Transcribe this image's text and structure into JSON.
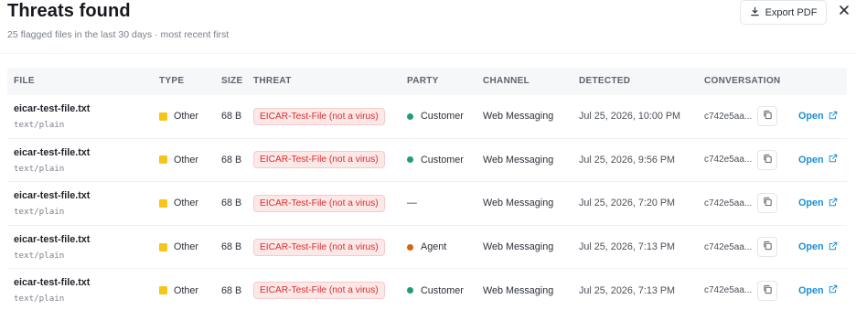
{
  "header": {
    "title": "Threats found",
    "subtitle": "25 flagged files in the last 30 days · most recent first",
    "export_label": "Export PDF"
  },
  "columns": {
    "file": "FILE",
    "type": "TYPE",
    "size": "SIZE",
    "threat": "THREAT",
    "party": "PARTY",
    "channel": "CHANNEL",
    "detected": "DETECTED",
    "conversation": "CONVERSATION"
  },
  "colors": {
    "type_other": "#f5c518",
    "party_customer": "#1f9e6e",
    "party_agent": "#d9630f",
    "threat_text": "#d92d2d",
    "threat_bg": "#fde8e8",
    "link": "#1a8ed6"
  },
  "rows": [
    {
      "file": "eicar-test-file.txt",
      "mime": "text/plain",
      "type": "Other",
      "size": "68 B",
      "threat": "EICAR-Test-File (not a virus)",
      "party": "Customer",
      "party_kind": "customer",
      "channel": "Web Messaging",
      "detected": "Jul 25, 2026, 10:00 PM",
      "conversation": "c742e5aa...",
      "open": "Open"
    },
    {
      "file": "eicar-test-file.txt",
      "mime": "text/plain",
      "type": "Other",
      "size": "68 B",
      "threat": "EICAR-Test-File (not a virus)",
      "party": "Customer",
      "party_kind": "customer",
      "channel": "Web Messaging",
      "detected": "Jul 25, 2026, 9:56 PM",
      "conversation": "c742e5aa...",
      "open": "Open"
    },
    {
      "file": "eicar-test-file.txt",
      "mime": "text/plain",
      "type": "Other",
      "size": "68 B",
      "threat": "EICAR-Test-File (not a virus)",
      "party": "—",
      "party_kind": "none",
      "channel": "Web Messaging",
      "detected": "Jul 25, 2026, 7:20 PM",
      "conversation": "c742e5aa...",
      "open": "Open"
    },
    {
      "file": "eicar-test-file.txt",
      "mime": "text/plain",
      "type": "Other",
      "size": "68 B",
      "threat": "EICAR-Test-File (not a virus)",
      "party": "Agent",
      "party_kind": "agent",
      "channel": "Web Messaging",
      "detected": "Jul 25, 2026, 7:13 PM",
      "conversation": "c742e5aa...",
      "open": "Open"
    },
    {
      "file": "eicar-test-file.txt",
      "mime": "text/plain",
      "type": "Other",
      "size": "68 B",
      "threat": "EICAR-Test-File (not a virus)",
      "party": "Customer",
      "party_kind": "customer",
      "channel": "Web Messaging",
      "detected": "Jul 25, 2026, 7:13 PM",
      "conversation": "c742e5aa...",
      "open": "Open"
    }
  ]
}
